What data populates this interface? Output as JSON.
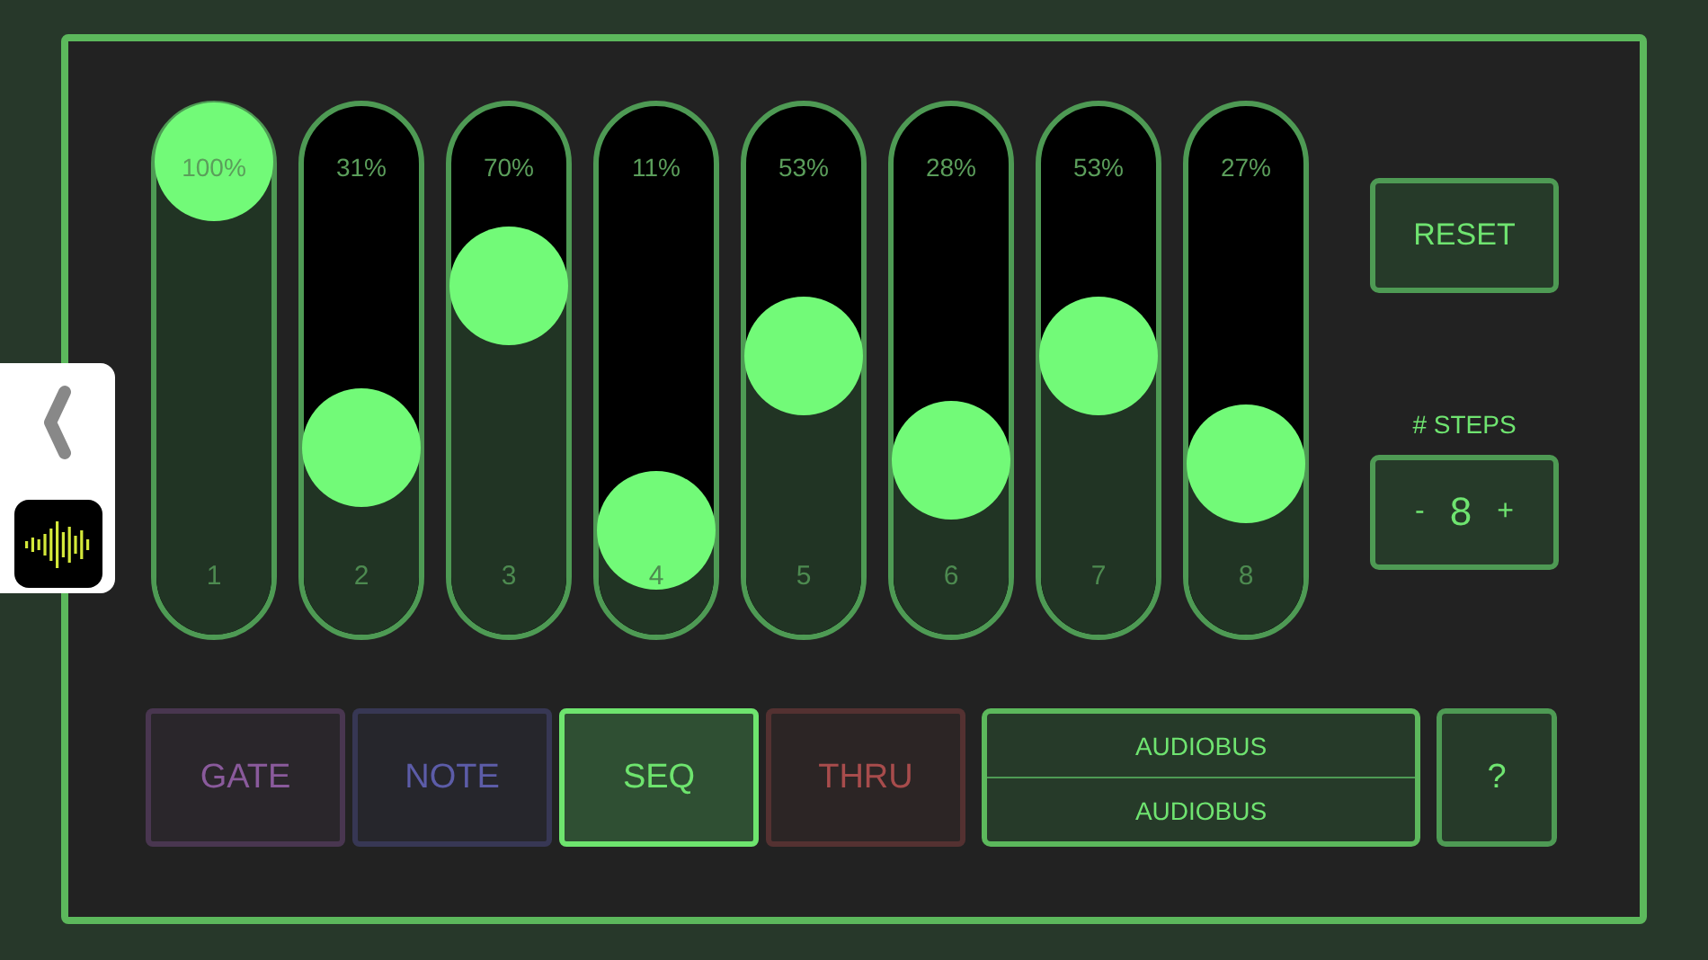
{
  "sliders": [
    {
      "reading": "100%",
      "step": "1",
      "level": 1.0
    },
    {
      "reading": "31%",
      "step": "2",
      "level": 0.31
    },
    {
      "reading": "70%",
      "step": "3",
      "level": 0.7
    },
    {
      "reading": "11%",
      "step": "4",
      "level": 0.11
    },
    {
      "reading": "53%",
      "step": "5",
      "level": 0.53
    },
    {
      "reading": "28%",
      "step": "6",
      "level": 0.28
    },
    {
      "reading": "53%",
      "step": "7",
      "level": 0.53
    },
    {
      "reading": "27%",
      "step": "8",
      "level": 0.27
    }
  ],
  "reset": "RESET",
  "steps": {
    "label": "# STEPS",
    "minus": "-",
    "value": "8",
    "plus": "+"
  },
  "modes": [
    {
      "label": "GATE",
      "color": "#8a5a9c",
      "selected": false
    },
    {
      "label": "NOTE",
      "color": "#5c5ca8",
      "selected": false
    },
    {
      "label": "SEQ",
      "color": "#6ee46e",
      "selected": true
    },
    {
      "label": "THRU",
      "color": "#a84c4c",
      "selected": false
    }
  ],
  "audiobus": [
    "AUDIOBUS",
    "AUDIOBUS"
  ],
  "help": "?"
}
